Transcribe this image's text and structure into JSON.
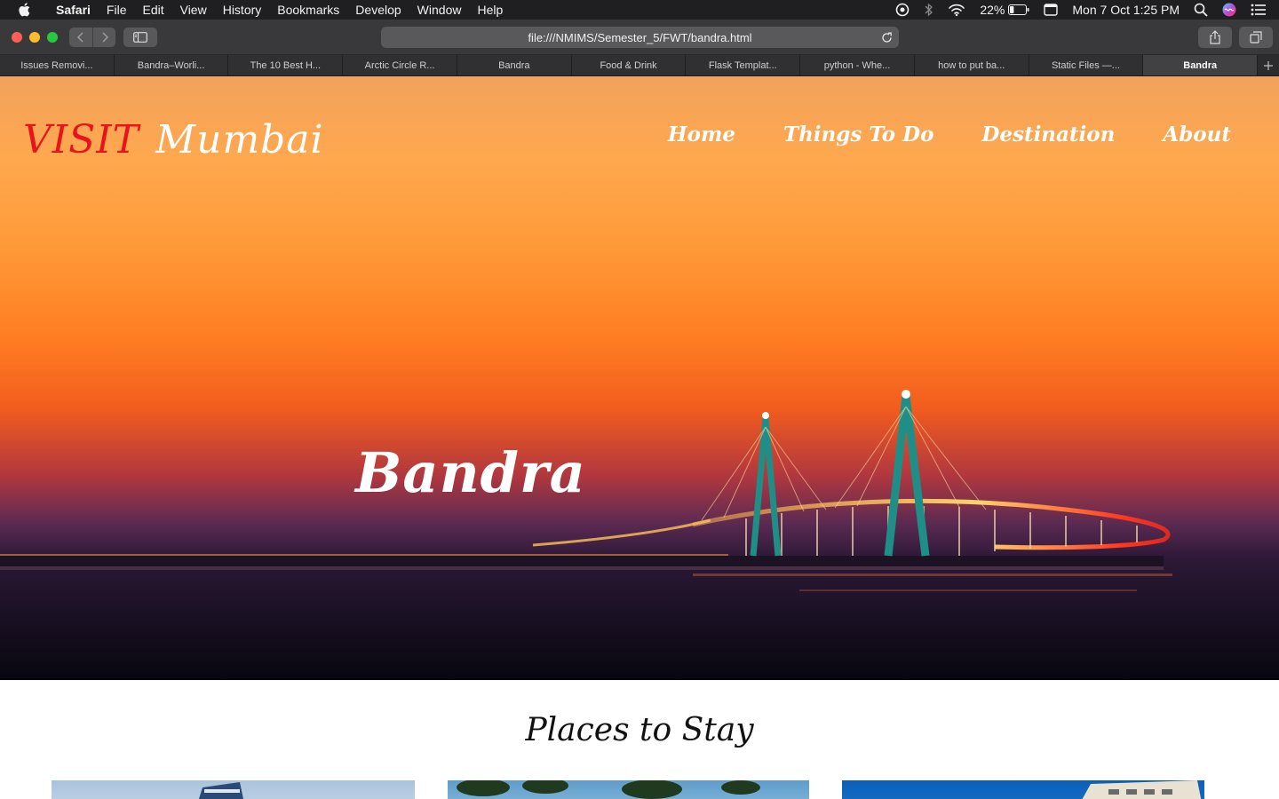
{
  "menubar": {
    "app_name": "Safari",
    "menus": [
      "File",
      "Edit",
      "View",
      "History",
      "Bookmarks",
      "Develop",
      "Window",
      "Help"
    ],
    "battery": "22%",
    "datetime": "Mon 7 Oct  1:25 PM"
  },
  "toolbar": {
    "url": "file:///NMIMS/Semester_5/FWT/bandra.html"
  },
  "tabs": [
    {
      "label": "Issues Removi..."
    },
    {
      "label": "Bandra–Worli..."
    },
    {
      "label": "The 10 Best H..."
    },
    {
      "label": "Arctic Circle R..."
    },
    {
      "label": "Bandra"
    },
    {
      "label": "Food & Drink"
    },
    {
      "label": "Flask Templat..."
    },
    {
      "label": "python - Whe..."
    },
    {
      "label": "how to put ba..."
    },
    {
      "label": "Static Files —..."
    },
    {
      "label": "Bandra",
      "active": true
    }
  ],
  "site": {
    "brand_visit": "VISIT",
    "brand_city": "Mumbai",
    "nav": [
      "Home",
      "Things To Do",
      "Destination",
      "About"
    ],
    "hero_title": "Bandra",
    "section_title": "Places to Stay"
  },
  "colors": {
    "brand_red": "#e8141c",
    "menubar_bg": "#1f1f21",
    "toolbar_bg": "#39393b"
  }
}
